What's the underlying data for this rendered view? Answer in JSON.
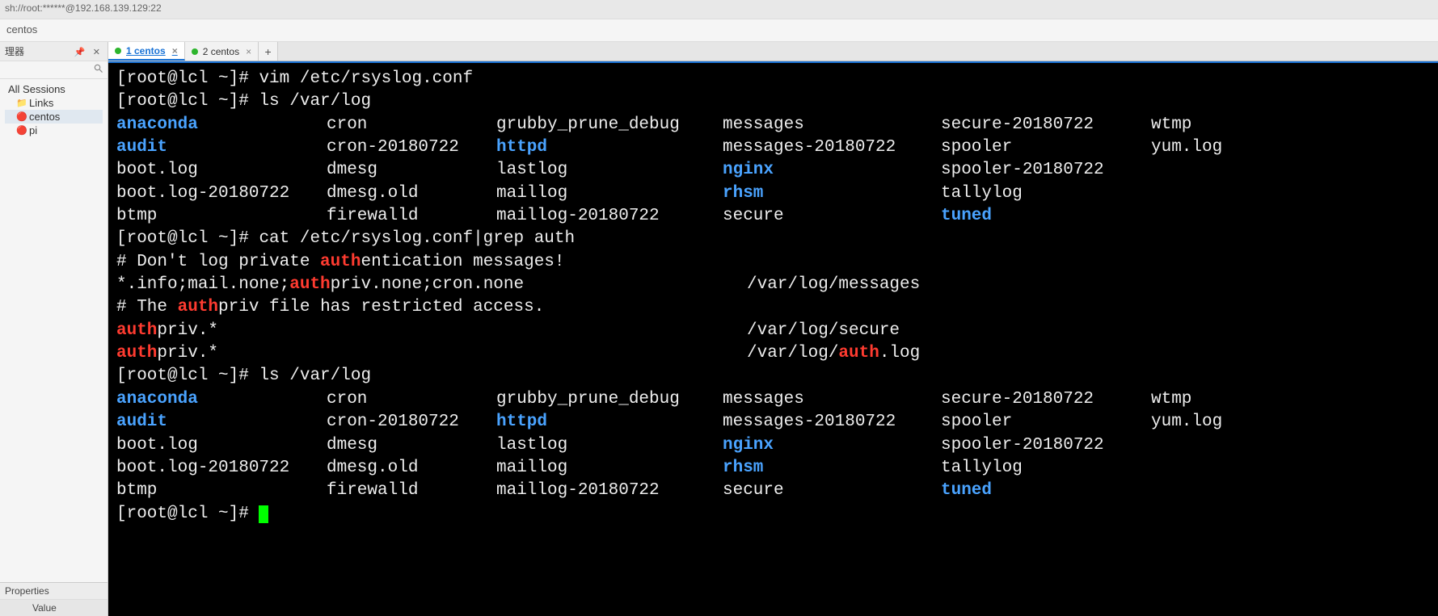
{
  "window": {
    "title": "sh://root:******@192.168.139.129:22"
  },
  "breadcrumb": "centos",
  "sidebar": {
    "header_label": "理器",
    "sessions_label": "All Sessions",
    "items": [
      {
        "label": "Links",
        "icon": "📁",
        "kind": "folder"
      },
      {
        "label": "centos",
        "icon": "🔴",
        "kind": "session",
        "selected": true
      },
      {
        "label": "pi",
        "icon": "🔴",
        "kind": "session"
      }
    ],
    "properties_label": "Properties",
    "value_label": "Value"
  },
  "tabs": [
    {
      "label": "1 centos",
      "active": true,
      "dot": "green"
    },
    {
      "label": "2 centos",
      "active": false,
      "dot": "green"
    }
  ],
  "terminal": {
    "prompt": "[root@lcl ~]# ",
    "cmds": {
      "vim": "vim /etc/rsyslog.conf",
      "ls1": "ls /var/log",
      "grep": "cat /etc/rsyslog.conf|grep auth",
      "ls2": "ls /var/log"
    },
    "ls_rows": [
      [
        "anaconda",
        "cron",
        "grubby_prune_debug",
        "messages",
        "secure-20180722",
        "wtmp"
      ],
      [
        "audit",
        "cron-20180722",
        "httpd",
        "messages-20180722",
        "spooler",
        "yum.log"
      ],
      [
        "boot.log",
        "dmesg",
        "lastlog",
        "nginx",
        "spooler-20180722",
        ""
      ],
      [
        "boot.log-20180722",
        "dmesg.old",
        "maillog",
        "rhsm",
        "tallylog",
        ""
      ],
      [
        "btmp",
        "firewalld",
        "maillog-20180722",
        "secure",
        "tuned",
        ""
      ]
    ],
    "ls_dirs": [
      "anaconda",
      "audit",
      "httpd",
      "nginx",
      "rhsm",
      "tuned"
    ],
    "grep_lines": [
      {
        "left": "# Don't log private authentication messages!",
        "right": ""
      },
      {
        "left": "*.info;mail.none;authpriv.none;cron.none",
        "right": "/var/log/messages"
      },
      {
        "left": "# The authpriv file has restricted access.",
        "right": ""
      },
      {
        "left": "authpriv.*",
        "right": "/var/log/secure"
      },
      {
        "left": "authpriv.*",
        "right": "/var/log/auth.log"
      }
    ],
    "match": "auth"
  }
}
